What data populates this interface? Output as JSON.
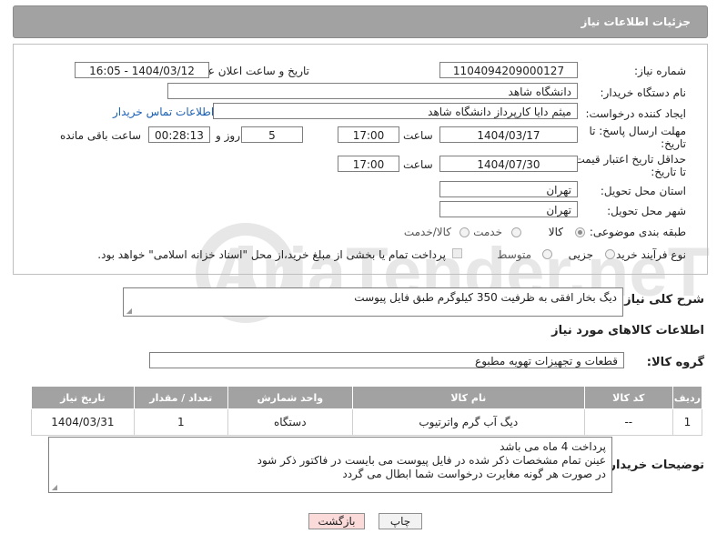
{
  "header": {
    "title": "جزئیات اطلاعات نیاز"
  },
  "fields": {
    "need_number_label": "شماره نیاز:",
    "need_number": "1104094209000127",
    "announce_label": "تاریخ و ساعت اعلان عمومی:",
    "announce_value": "1404/03/12 - 16:05",
    "buyer_org_label": "نام دستگاه خریدار:",
    "buyer_org": "دانشگاه شاهد",
    "creator_label": "ایجاد کننده درخواست:",
    "creator": "میثم دایا کارپرداز دانشگاه شاهد",
    "contact_link": "اطلاعات تماس خریدار",
    "deadline_label_1": "مهلت ارسال پاسخ: تا",
    "deadline_label_2": "تاریخ:",
    "deadline_date": "1404/03/17",
    "time_label": "ساعت",
    "deadline_time": "17:00",
    "days_value": "5",
    "days_label": "روز و",
    "remaining_time": "00:28:13",
    "remaining_label": "ساعت باقی مانده",
    "validity_label_1": "حداقل تاریخ اعتبار قیمت:",
    "validity_label_2": "تا تاریخ:",
    "validity_date": "1404/07/30",
    "validity_time": "17:00",
    "province_label": "استان محل تحویل:",
    "province": "تهران",
    "city_label": "شهر محل تحویل:",
    "city": "تهران",
    "category_label": "طبقه بندی موضوعی:",
    "category_options": [
      "کالا",
      "خدمت",
      "کالا/خدمت"
    ],
    "process_label": "نوع فرآیند خرید :",
    "process_options": [
      "جزیی",
      "متوسط"
    ],
    "payment_note": "پرداخت تمام یا بخشی از مبلغ خرید،از محل \"اسناد خزانه اسلامی\" خواهد بود."
  },
  "description": {
    "label": "شرح کلی نیاز:",
    "value": "دیگ بخار افقی به ظرفیت 350 کیلوگرم طبق فایل پیوست"
  },
  "goods_section": {
    "title": "اطلاعات کالاهای مورد نیاز",
    "group_label": "گروه کالا:",
    "group_value": "قطعات و تجهیزات تهویه مطبوع"
  },
  "table": {
    "headers": [
      "ردیف",
      "کد کالا",
      "نام کالا",
      "واحد شمارش",
      "تعداد / مقدار",
      "تاریخ نیاز"
    ],
    "rows": [
      [
        "1",
        "--",
        "دیگ آب گرم واترتیوب",
        "دستگاه",
        "1",
        "1404/03/31"
      ]
    ]
  },
  "buyer_notes": {
    "label": "توضیحات خریدار:",
    "lines": [
      "پرداخت 4 ماه می باشد",
      "عینن تمام مشخصات ذکر شده در فایل پیوست می بایست در فاکتور ذکر شود",
      "در صورت هر گونه مغایرت درخواست شما ابطال می گردد"
    ]
  },
  "buttons": {
    "print": "چاپ",
    "back": "بازگشت"
  },
  "watermark": {
    "text": "AriaTender.neT"
  }
}
